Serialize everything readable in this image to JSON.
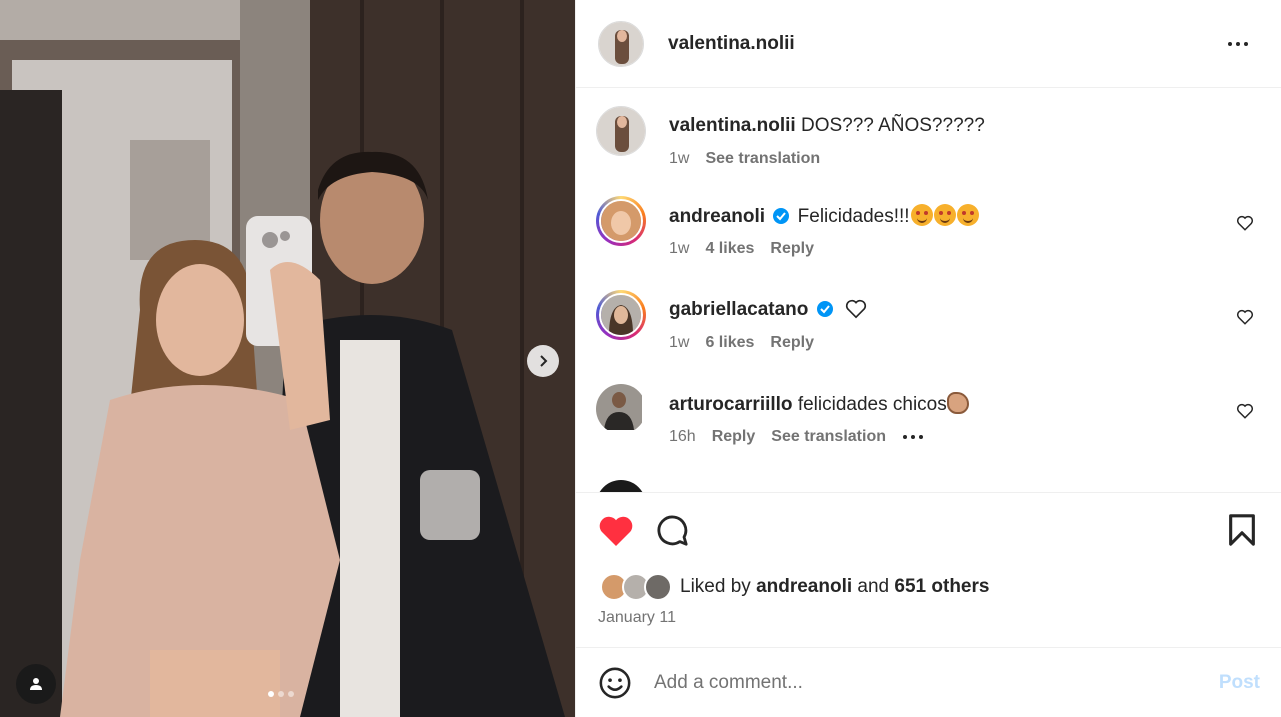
{
  "accent_color": "#0095f6",
  "like_color": "#ff3040",
  "media": {
    "next_icon": "chevron-right-icon",
    "tag_icon": "person-icon",
    "carousel_count": 3,
    "carousel_active": 1
  },
  "header": {
    "username": "valentina.nolii",
    "more_icon": "more-horizontal-icon"
  },
  "caption": {
    "username": "valentina.nolii",
    "text": "DOS??? AÑOS?????",
    "time": "1w",
    "translate": "See translation"
  },
  "comments": [
    {
      "username": "andreanoli",
      "verified": true,
      "text": "Felicidades!!!",
      "emoji": "smiling-face-with-hearts-emoji x3",
      "time": "1w",
      "likes": "4 likes",
      "reply": "Reply"
    },
    {
      "username": "gabriellacatano",
      "verified": true,
      "emoji": "white-heart-emoji",
      "time": "1w",
      "likes": "6 likes",
      "reply": "Reply"
    },
    {
      "username": "arturocarriillo",
      "text": "felicidades chicos",
      "emoji": "clapping-hands-emoji",
      "time": "16h",
      "reply": "Reply",
      "translate": "See translation"
    }
  ],
  "actions": {
    "like_icon": "heart-filled-icon",
    "comment_icon": "comment-icon",
    "save_icon": "bookmark-icon"
  },
  "likes": {
    "prefix": "Liked by",
    "user": "andreanoli",
    "and": "and",
    "others": "651 others"
  },
  "date": "January 11",
  "comment_box": {
    "placeholder": "Add a comment...",
    "post_label": "Post",
    "emoji_icon": "smiley-icon"
  }
}
